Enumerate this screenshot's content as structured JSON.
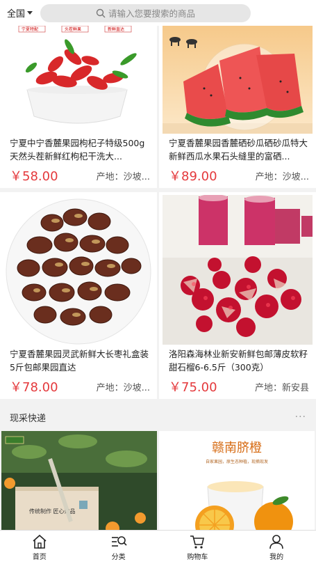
{
  "header": {
    "region": "全国",
    "search_placeholder": "请输入您要搜索的商品"
  },
  "products": [
    {
      "title": "宁夏中宁香麓果园枸杞子特级500g天然头茬新鲜红枸杞干洗大...",
      "price": "￥58.00",
      "origin": "产地：沙坡..."
    },
    {
      "title": "宁夏香麓果园香麓硒砂瓜硒砂瓜特大新鲜西瓜水果石头缝里的富硒...",
      "price": "￥89.00",
      "origin": "产地：沙坡..."
    },
    {
      "title": "宁夏香麓果园灵武新鲜大长枣礼盒装5斤包邮果园直达",
      "price": "￥78.00",
      "origin": "产地：沙坡..."
    },
    {
      "title": "洛阳森海林业新安新鲜包邮薄皮软籽甜石榴6-6.5斤（300克）",
      "price": "￥75.00",
      "origin": "产地：新安县"
    }
  ],
  "product_image_text": {
    "goji_labels": [
      "宁夏特配",
      "头茬鲜果",
      "新鲜直达"
    ],
    "tea_box": "传统制作 匠心臻品",
    "orange_brand": "赣南脐橙",
    "orange_sub": "自家果园，原生态种植，现摘现发"
  },
  "section": {
    "label": "现采快递",
    "more": "···"
  },
  "tabbar": [
    {
      "label": "首页",
      "icon": "home-icon"
    },
    {
      "label": "分类",
      "icon": "category-icon"
    },
    {
      "label": "购物车",
      "icon": "cart-icon"
    },
    {
      "label": "我的",
      "icon": "user-icon"
    }
  ],
  "colors": {
    "price": "#e4393c",
    "background": "#f2f2f2",
    "search_bg": "#e6e6e6"
  }
}
